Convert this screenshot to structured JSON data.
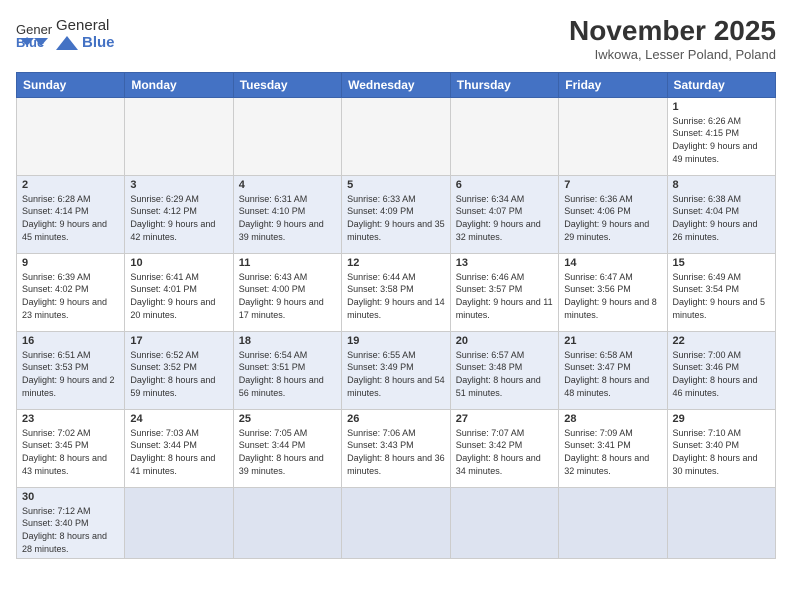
{
  "header": {
    "logo_general": "General",
    "logo_blue": "Blue",
    "month_title": "November 2025",
    "subtitle": "Iwkowa, Lesser Poland, Poland"
  },
  "days_of_week": [
    "Sunday",
    "Monday",
    "Tuesday",
    "Wednesday",
    "Thursday",
    "Friday",
    "Saturday"
  ],
  "weeks": [
    [
      {
        "day": "",
        "info": ""
      },
      {
        "day": "",
        "info": ""
      },
      {
        "day": "",
        "info": ""
      },
      {
        "day": "",
        "info": ""
      },
      {
        "day": "",
        "info": ""
      },
      {
        "day": "",
        "info": ""
      },
      {
        "day": "1",
        "info": "Sunrise: 6:26 AM\nSunset: 4:15 PM\nDaylight: 9 hours and 49 minutes."
      }
    ],
    [
      {
        "day": "2",
        "info": "Sunrise: 6:28 AM\nSunset: 4:14 PM\nDaylight: 9 hours and 45 minutes."
      },
      {
        "day": "3",
        "info": "Sunrise: 6:29 AM\nSunset: 4:12 PM\nDaylight: 9 hours and 42 minutes."
      },
      {
        "day": "4",
        "info": "Sunrise: 6:31 AM\nSunset: 4:10 PM\nDaylight: 9 hours and 39 minutes."
      },
      {
        "day": "5",
        "info": "Sunrise: 6:33 AM\nSunset: 4:09 PM\nDaylight: 9 hours and 35 minutes."
      },
      {
        "day": "6",
        "info": "Sunrise: 6:34 AM\nSunset: 4:07 PM\nDaylight: 9 hours and 32 minutes."
      },
      {
        "day": "7",
        "info": "Sunrise: 6:36 AM\nSunset: 4:06 PM\nDaylight: 9 hours and 29 minutes."
      },
      {
        "day": "8",
        "info": "Sunrise: 6:38 AM\nSunset: 4:04 PM\nDaylight: 9 hours and 26 minutes."
      }
    ],
    [
      {
        "day": "9",
        "info": "Sunrise: 6:39 AM\nSunset: 4:02 PM\nDaylight: 9 hours and 23 minutes."
      },
      {
        "day": "10",
        "info": "Sunrise: 6:41 AM\nSunset: 4:01 PM\nDaylight: 9 hours and 20 minutes."
      },
      {
        "day": "11",
        "info": "Sunrise: 6:43 AM\nSunset: 4:00 PM\nDaylight: 9 hours and 17 minutes."
      },
      {
        "day": "12",
        "info": "Sunrise: 6:44 AM\nSunset: 3:58 PM\nDaylight: 9 hours and 14 minutes."
      },
      {
        "day": "13",
        "info": "Sunrise: 6:46 AM\nSunset: 3:57 PM\nDaylight: 9 hours and 11 minutes."
      },
      {
        "day": "14",
        "info": "Sunrise: 6:47 AM\nSunset: 3:56 PM\nDaylight: 9 hours and 8 minutes."
      },
      {
        "day": "15",
        "info": "Sunrise: 6:49 AM\nSunset: 3:54 PM\nDaylight: 9 hours and 5 minutes."
      }
    ],
    [
      {
        "day": "16",
        "info": "Sunrise: 6:51 AM\nSunset: 3:53 PM\nDaylight: 9 hours and 2 minutes."
      },
      {
        "day": "17",
        "info": "Sunrise: 6:52 AM\nSunset: 3:52 PM\nDaylight: 8 hours and 59 minutes."
      },
      {
        "day": "18",
        "info": "Sunrise: 6:54 AM\nSunset: 3:51 PM\nDaylight: 8 hours and 56 minutes."
      },
      {
        "day": "19",
        "info": "Sunrise: 6:55 AM\nSunset: 3:49 PM\nDaylight: 8 hours and 54 minutes."
      },
      {
        "day": "20",
        "info": "Sunrise: 6:57 AM\nSunset: 3:48 PM\nDaylight: 8 hours and 51 minutes."
      },
      {
        "day": "21",
        "info": "Sunrise: 6:58 AM\nSunset: 3:47 PM\nDaylight: 8 hours and 48 minutes."
      },
      {
        "day": "22",
        "info": "Sunrise: 7:00 AM\nSunset: 3:46 PM\nDaylight: 8 hours and 46 minutes."
      }
    ],
    [
      {
        "day": "23",
        "info": "Sunrise: 7:02 AM\nSunset: 3:45 PM\nDaylight: 8 hours and 43 minutes."
      },
      {
        "day": "24",
        "info": "Sunrise: 7:03 AM\nSunset: 3:44 PM\nDaylight: 8 hours and 41 minutes."
      },
      {
        "day": "25",
        "info": "Sunrise: 7:05 AM\nSunset: 3:44 PM\nDaylight: 8 hours and 39 minutes."
      },
      {
        "day": "26",
        "info": "Sunrise: 7:06 AM\nSunset: 3:43 PM\nDaylight: 8 hours and 36 minutes."
      },
      {
        "day": "27",
        "info": "Sunrise: 7:07 AM\nSunset: 3:42 PM\nDaylight: 8 hours and 34 minutes."
      },
      {
        "day": "28",
        "info": "Sunrise: 7:09 AM\nSunset: 3:41 PM\nDaylight: 8 hours and 32 minutes."
      },
      {
        "day": "29",
        "info": "Sunrise: 7:10 AM\nSunset: 3:40 PM\nDaylight: 8 hours and 30 minutes."
      }
    ],
    [
      {
        "day": "30",
        "info": "Sunrise: 7:12 AM\nSunset: 3:40 PM\nDaylight: 8 hours and 28 minutes."
      },
      {
        "day": "",
        "info": ""
      },
      {
        "day": "",
        "info": ""
      },
      {
        "day": "",
        "info": ""
      },
      {
        "day": "",
        "info": ""
      },
      {
        "day": "",
        "info": ""
      },
      {
        "day": "",
        "info": ""
      }
    ]
  ]
}
